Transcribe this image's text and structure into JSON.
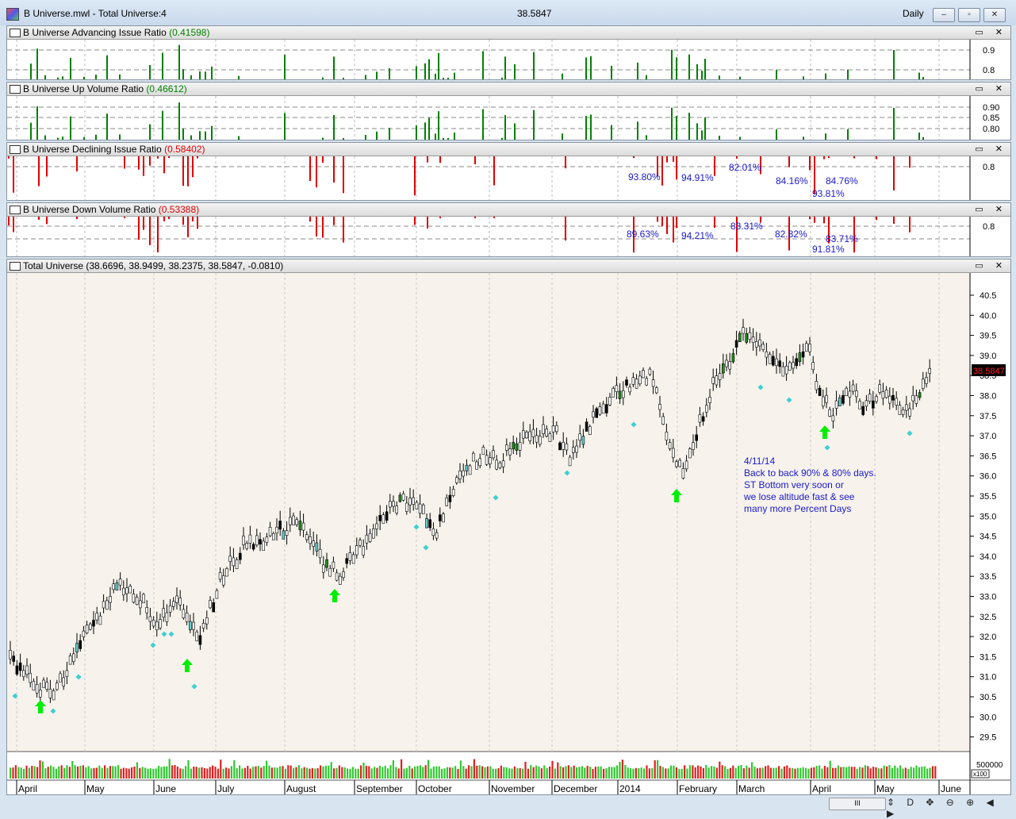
{
  "window": {
    "title": "B Universe.mwl - Total Universe:4",
    "price": "38.5847",
    "period": "Daily",
    "btn_min": "–",
    "btn_max": "▫",
    "btn_close": "✕"
  },
  "panes": {
    "adv": {
      "name": "B Universe Advancing Issue Ratio",
      "value": "(0.41598)",
      "axis": [
        "0.9",
        "0.8"
      ]
    },
    "upvol": {
      "name": "B Universe Up Volume Ratio",
      "value": "(0.46612)",
      "axis": [
        "0.90",
        "0.85",
        "0.80"
      ]
    },
    "decl": {
      "name": "B Universe Declining Issue Ratio",
      "value": "(0.58402)",
      "axis": [
        "0.8"
      ]
    },
    "downvol": {
      "name": "B Universe Down Volume Ratio",
      "value": "(0.53388)",
      "axis": [
        "0.8"
      ]
    },
    "main": {
      "name": "Total Universe",
      "value": "(38.6696, 38.9499, 38.2375, 38.5847, -0.0810)",
      "last_price": "38.5847"
    },
    "pane_buttons": "▭ ✕"
  },
  "annotations": {
    "decl_pcts": [
      "93.80%",
      "94.91%",
      "82.01%",
      "84.16%",
      "84.76%",
      "93.81%"
    ],
    "down_pcts": [
      "89.63%",
      "94.21%",
      "83.31%",
      "82.82%",
      "83.71%",
      "91.81%"
    ],
    "note": [
      "4/11/14",
      "Back to back 90% & 80% days.",
      "ST Bottom very soon or",
      "we lose altitude fast & see",
      "many more Percent Days"
    ]
  },
  "price_axis": [
    "40.5",
    "40.0",
    "39.5",
    "39.0",
    "38.5",
    "38.0",
    "37.5",
    "37.0",
    "36.5",
    "36.0",
    "35.5",
    "35.0",
    "34.5",
    "34.0",
    "33.5",
    "33.0",
    "32.5",
    "32.0",
    "31.5",
    "31.0",
    "30.5",
    "30.0",
    "29.5"
  ],
  "volume_axis": {
    "label": "500000",
    "sub": "x100"
  },
  "months": [
    "April",
    "May",
    "June",
    "July",
    "August",
    "September",
    "October",
    "November",
    "December",
    "2014",
    "February",
    "March",
    "April",
    "May",
    "June"
  ],
  "scrollbar": "III",
  "nav_icons": "⇕ D ✥ ⊖ ⊕ ◀ ▶",
  "colors": {
    "advance": "#008000",
    "decline": "#e00000",
    "pct_text": "#1a1acc",
    "arrow": "#00ee00",
    "dot": "#40d0d0",
    "chart_bg": "#f7f3ec"
  }
}
